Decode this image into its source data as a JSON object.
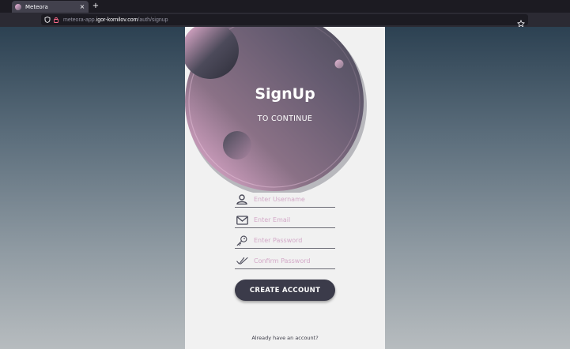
{
  "browser": {
    "tab_title": "Meteora",
    "tab_close": "×",
    "new_tab": "+",
    "url_prefix": "meteora-app.",
    "url_host": "igor-kornilov.com",
    "url_path": "/auth/signup"
  },
  "hero": {
    "title": "SignUp",
    "subtitle": "TO CONTINUE"
  },
  "form": {
    "username_placeholder": "Enter Username",
    "email_placeholder": "Enter Email",
    "password_placeholder": "Enter Password",
    "confirm_placeholder": "Confirm Password",
    "submit_label": "CREATE ACCOUNT"
  },
  "footer": {
    "text": "Already have an account?"
  },
  "colors": {
    "accent_dark": "#3b3b4a",
    "accent_pink": "#f2b6dc",
    "placeholder": "#d3a9c8",
    "card_bg": "#f1f1f1"
  },
  "icons": {
    "username": "user-icon",
    "email": "envelope-icon",
    "password": "key-icon",
    "confirm": "double-check-icon",
    "site_info": "shield-icon",
    "lock": "lock-icon",
    "bookmark": "star-icon"
  }
}
